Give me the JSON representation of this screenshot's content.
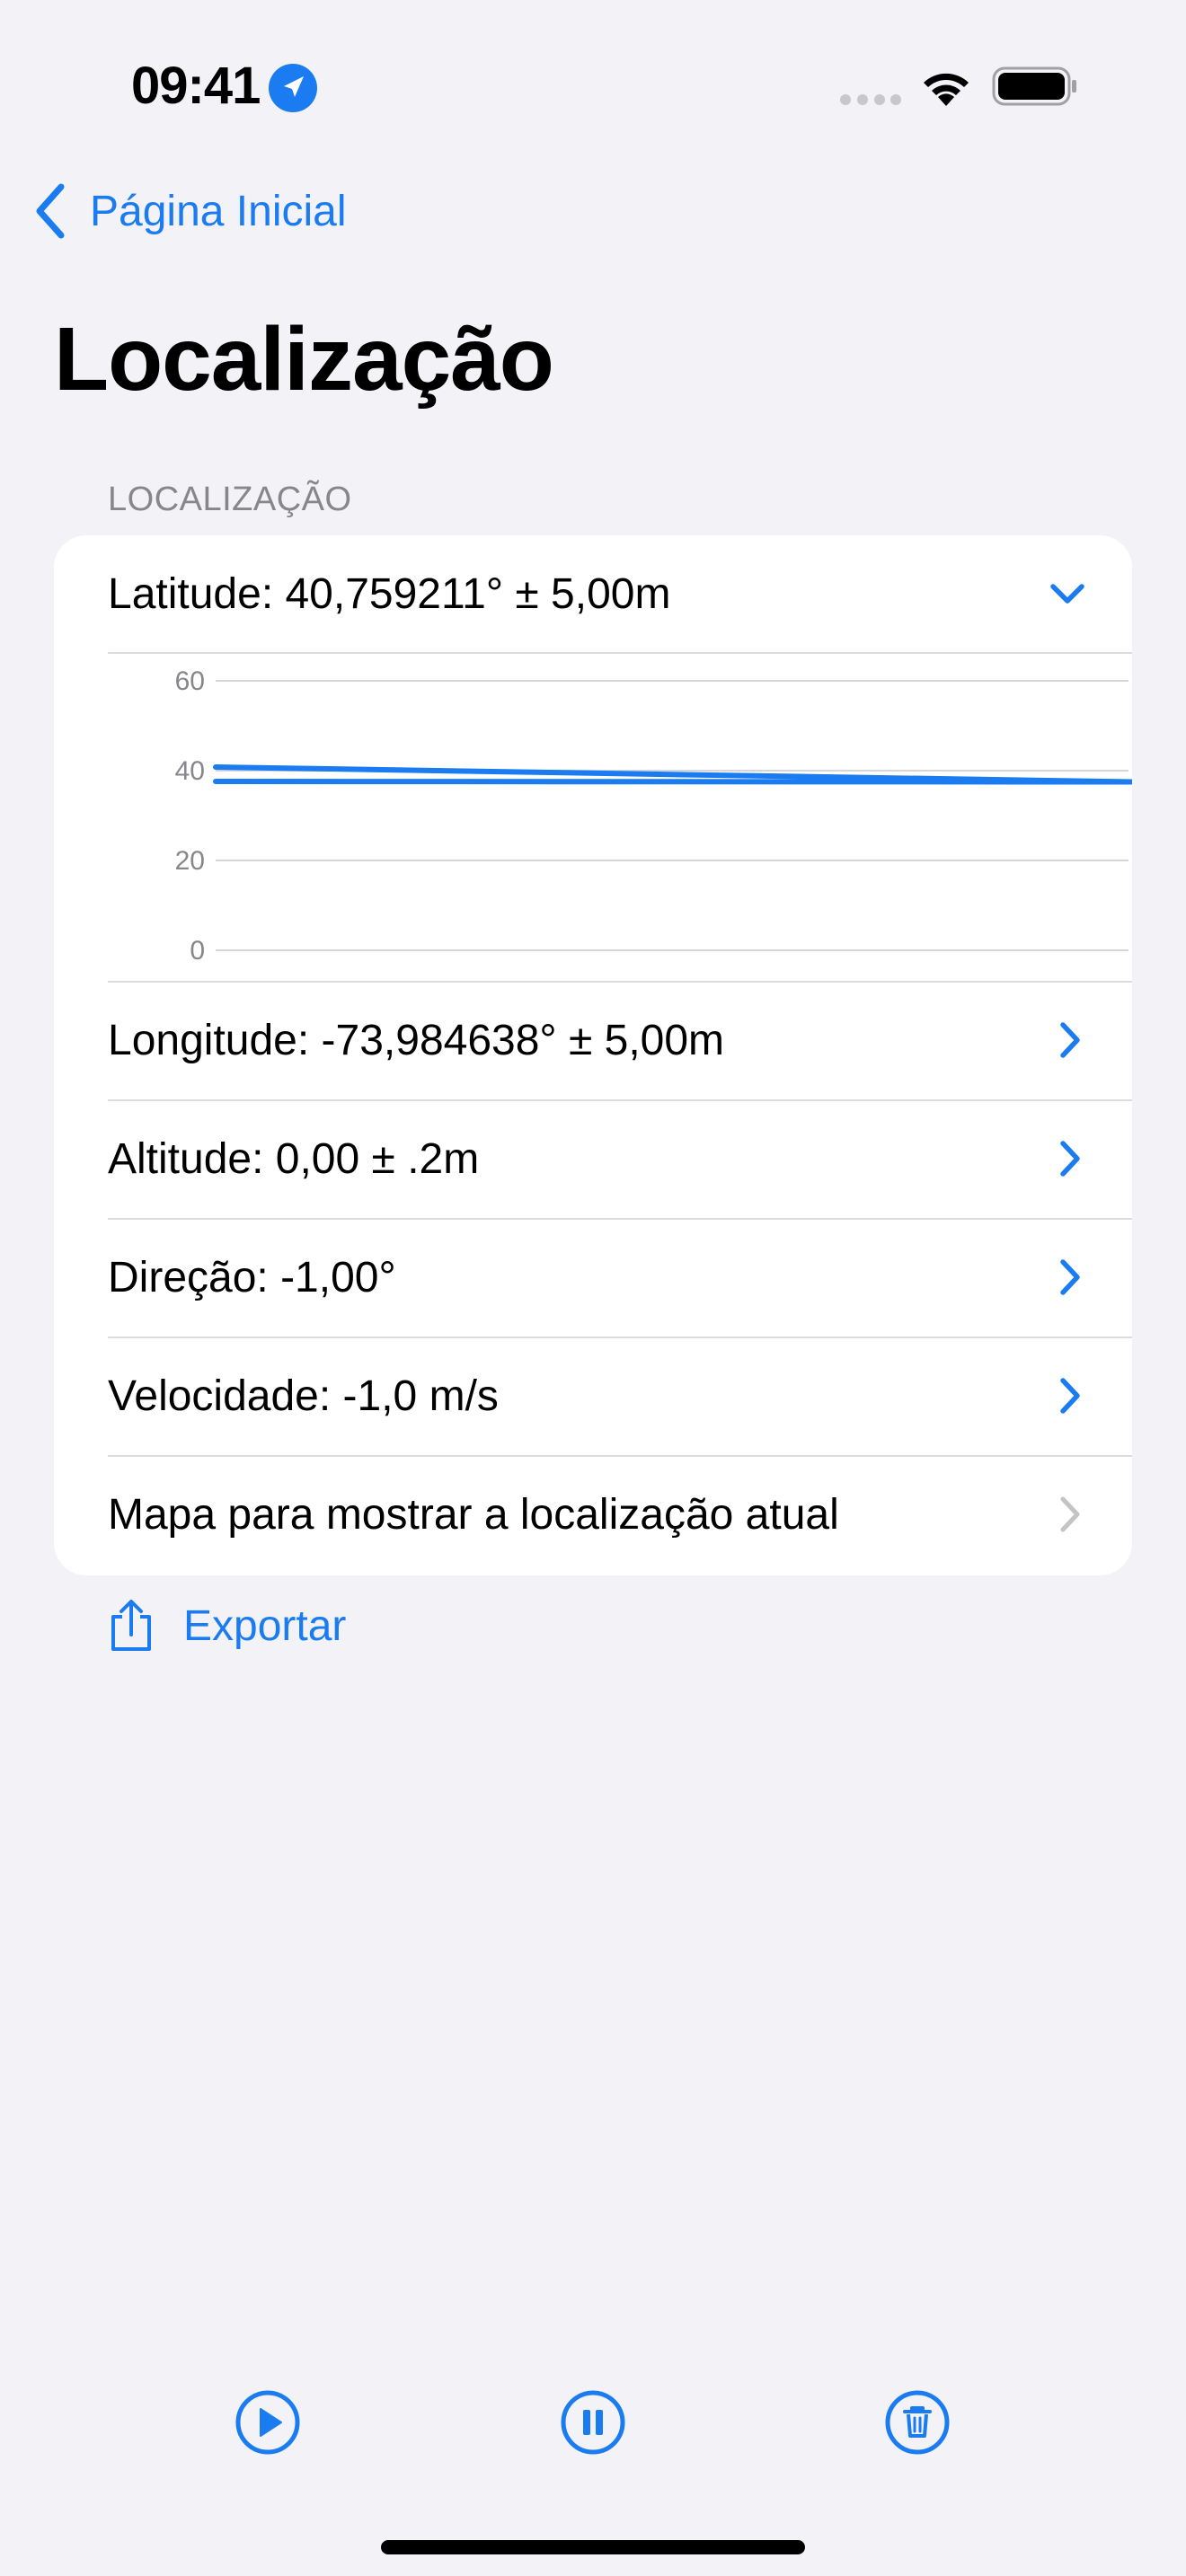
{
  "status_bar": {
    "time": "09:41",
    "location_icon": "location-arrow-icon",
    "signal_icon": "signal-dots-icon",
    "wifi_icon": "wifi-icon",
    "battery_icon": "battery-icon"
  },
  "nav": {
    "back_label": "Página Inicial",
    "back_icon": "chevron-left-icon"
  },
  "page": {
    "title": "Localização"
  },
  "section": {
    "header": "LOCALIZAÇÃO"
  },
  "rows": {
    "latitude": "Latitude: 40,759211° ± 5,00m",
    "longitude": "Longitude: -73,984638° ± 5,00m",
    "altitude": "Altitude: 0,00 ± .2m",
    "direction": "Direção: -1,00°",
    "speed": "Velocidade: -1,0 m/s",
    "map": "Mapa para mostrar a localização atual"
  },
  "chart_data": {
    "type": "line",
    "title": "",
    "xlabel": "",
    "ylabel": "",
    "ylim": [
      0,
      60
    ],
    "yticks": [
      "60",
      "40",
      "20",
      "0"
    ],
    "grid": true,
    "series": [
      {
        "x": [
          0,
          1
        ],
        "values": [
          40.8,
          37.5
        ],
        "color": "#1A7CF0"
      },
      {
        "x": [
          0,
          1
        ],
        "values": [
          37.6,
          37.5
        ],
        "color": "#1A7CF0"
      }
    ]
  },
  "export": {
    "label": "Exportar",
    "icon": "share-icon"
  },
  "toolbar": {
    "play_icon": "play-icon",
    "pause_icon": "pause-icon",
    "trash_icon": "trash-icon"
  },
  "colors": {
    "accent": "#1A7CF0",
    "background": "#F2F2F7",
    "card": "#FFFFFF",
    "secondary_text": "#86868B"
  }
}
